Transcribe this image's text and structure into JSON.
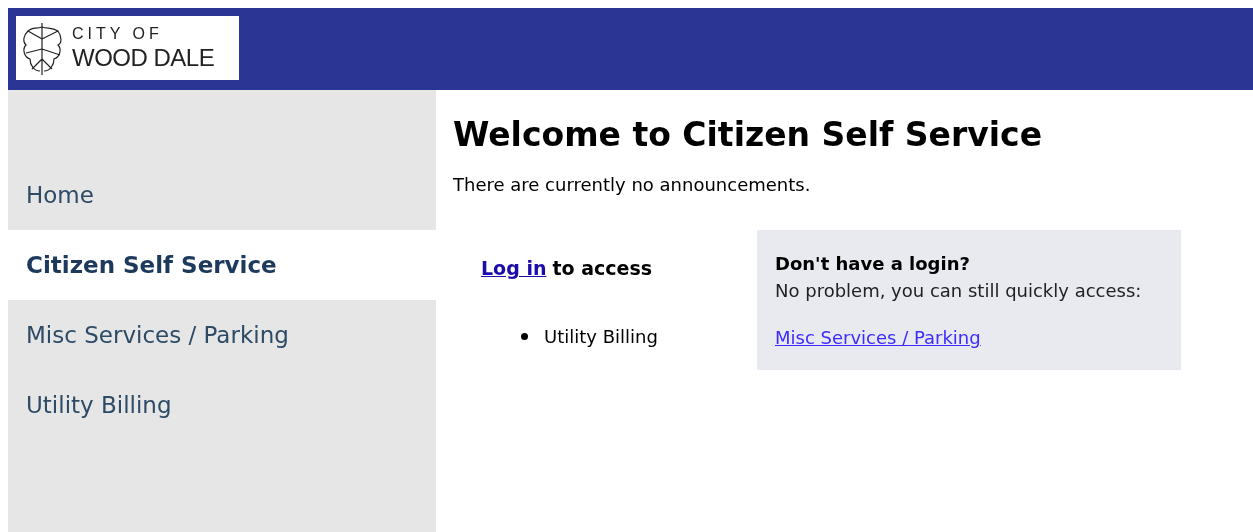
{
  "header": {
    "logo": {
      "line_1": "CITY OF",
      "line_2": "WOOD DALE"
    }
  },
  "sidebar": {
    "items": [
      {
        "label": "Home",
        "selected": false
      },
      {
        "label": "Citizen Self Service",
        "selected": true
      },
      {
        "label": "Misc Services / Parking",
        "selected": false
      },
      {
        "label": "Utility Billing",
        "selected": false
      }
    ]
  },
  "main": {
    "title": "Welcome to Citizen Self Service",
    "announcement": "There are currently no announcements.",
    "login": {
      "link": "Log in",
      "text": "to access",
      "items": [
        "Utility Billing"
      ]
    },
    "guest": {
      "title": "Don't have a login?",
      "text": "No problem, you can still quickly access:",
      "links": [
        "Misc Services / Parking"
      ]
    }
  }
}
